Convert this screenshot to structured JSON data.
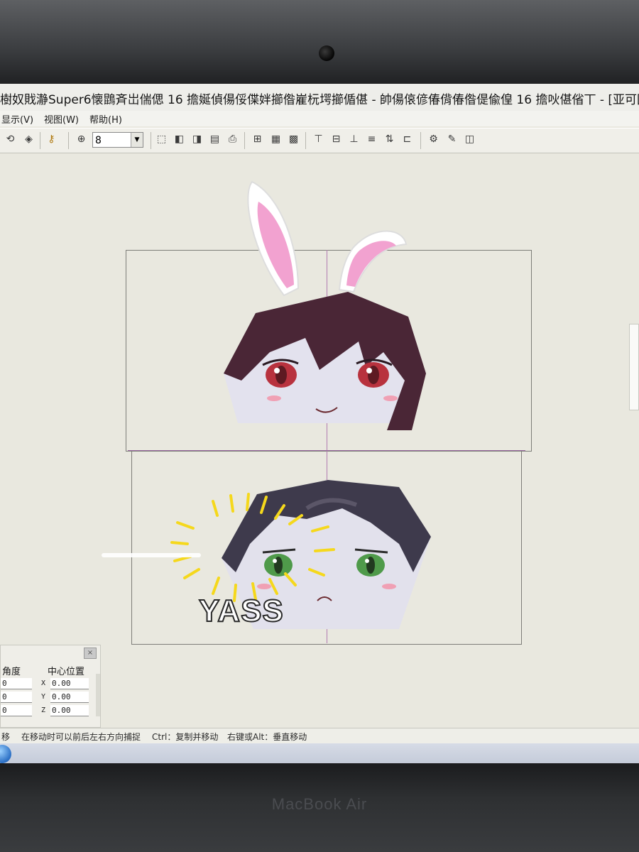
{
  "window": {
    "title": "樹奴戝瀞Super6懐鵾斉岀偳偲 16 擔娫偵偒俀偞姅擳偺嵟杬堮擳偱偡 - 帥偒偯偐偆偝偆偺偍偸偟 16 擔吙偡偗丅 - [亚可团子.d"
  },
  "menu": {
    "items": [
      "显示(V)",
      "视图(W)",
      "帮助(H)"
    ]
  },
  "toolbar": {
    "zoom_value": "8"
  },
  "canvas": {
    "sticker_text": "YASS"
  },
  "properties": {
    "angle_label": "角度",
    "center_label": "中心位置",
    "angle_values": [
      "0",
      "0",
      "0"
    ],
    "axes": [
      "X",
      "Y",
      "Z"
    ],
    "center_values": [
      "0.00",
      "0.00",
      "0.00"
    ]
  },
  "status": {
    "text1": "移",
    "text2": "在移动时可以前后左右方向捕捉",
    "text3": "Ctrl：复制并移动",
    "text4": "右键或Alt：垂直移动"
  },
  "device": {
    "brand_label": "MacBook Air"
  },
  "colors": {
    "hair_top": "#4a2636",
    "hair_bottom": "#3e3a4c",
    "eye_red": "#b8323e",
    "eye_green": "#4f9a4a",
    "bunny_pink": "#f2a2d0",
    "sticker_yellow": "#f5d81c"
  }
}
